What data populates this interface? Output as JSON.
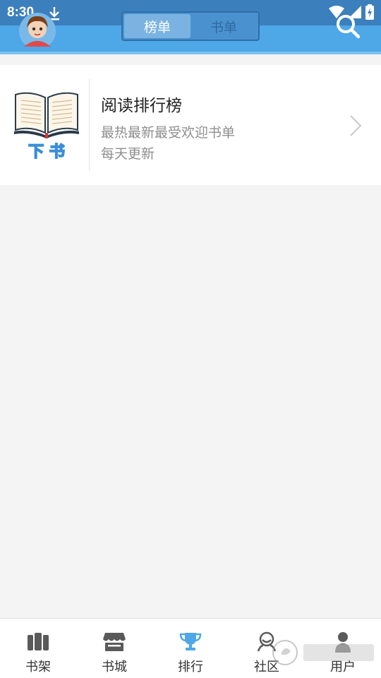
{
  "status_bar": {
    "time": "8:30"
  },
  "header": {
    "tabs": [
      {
        "label": "榜单",
        "active": true
      },
      {
        "label": "书单",
        "active": false
      }
    ],
    "accent_color": "#4ea7e6"
  },
  "card": {
    "icon_text": "下 书",
    "title": "阅读排行榜",
    "subtitle1": "最热最新最受欢迎书单",
    "subtitle2": "每天更新"
  },
  "bottom_nav": {
    "items": [
      {
        "label": "书架",
        "icon": "bookshelf-icon",
        "active": false
      },
      {
        "label": "书城",
        "icon": "store-icon",
        "active": false
      },
      {
        "label": "排行",
        "icon": "trophy-icon",
        "active": true
      },
      {
        "label": "社区",
        "icon": "community-icon",
        "active": false
      },
      {
        "label": "用户",
        "icon": "user-icon",
        "active": false
      }
    ],
    "active_color": "#4ea7e6",
    "inactive_color": "#5a5a5a"
  }
}
